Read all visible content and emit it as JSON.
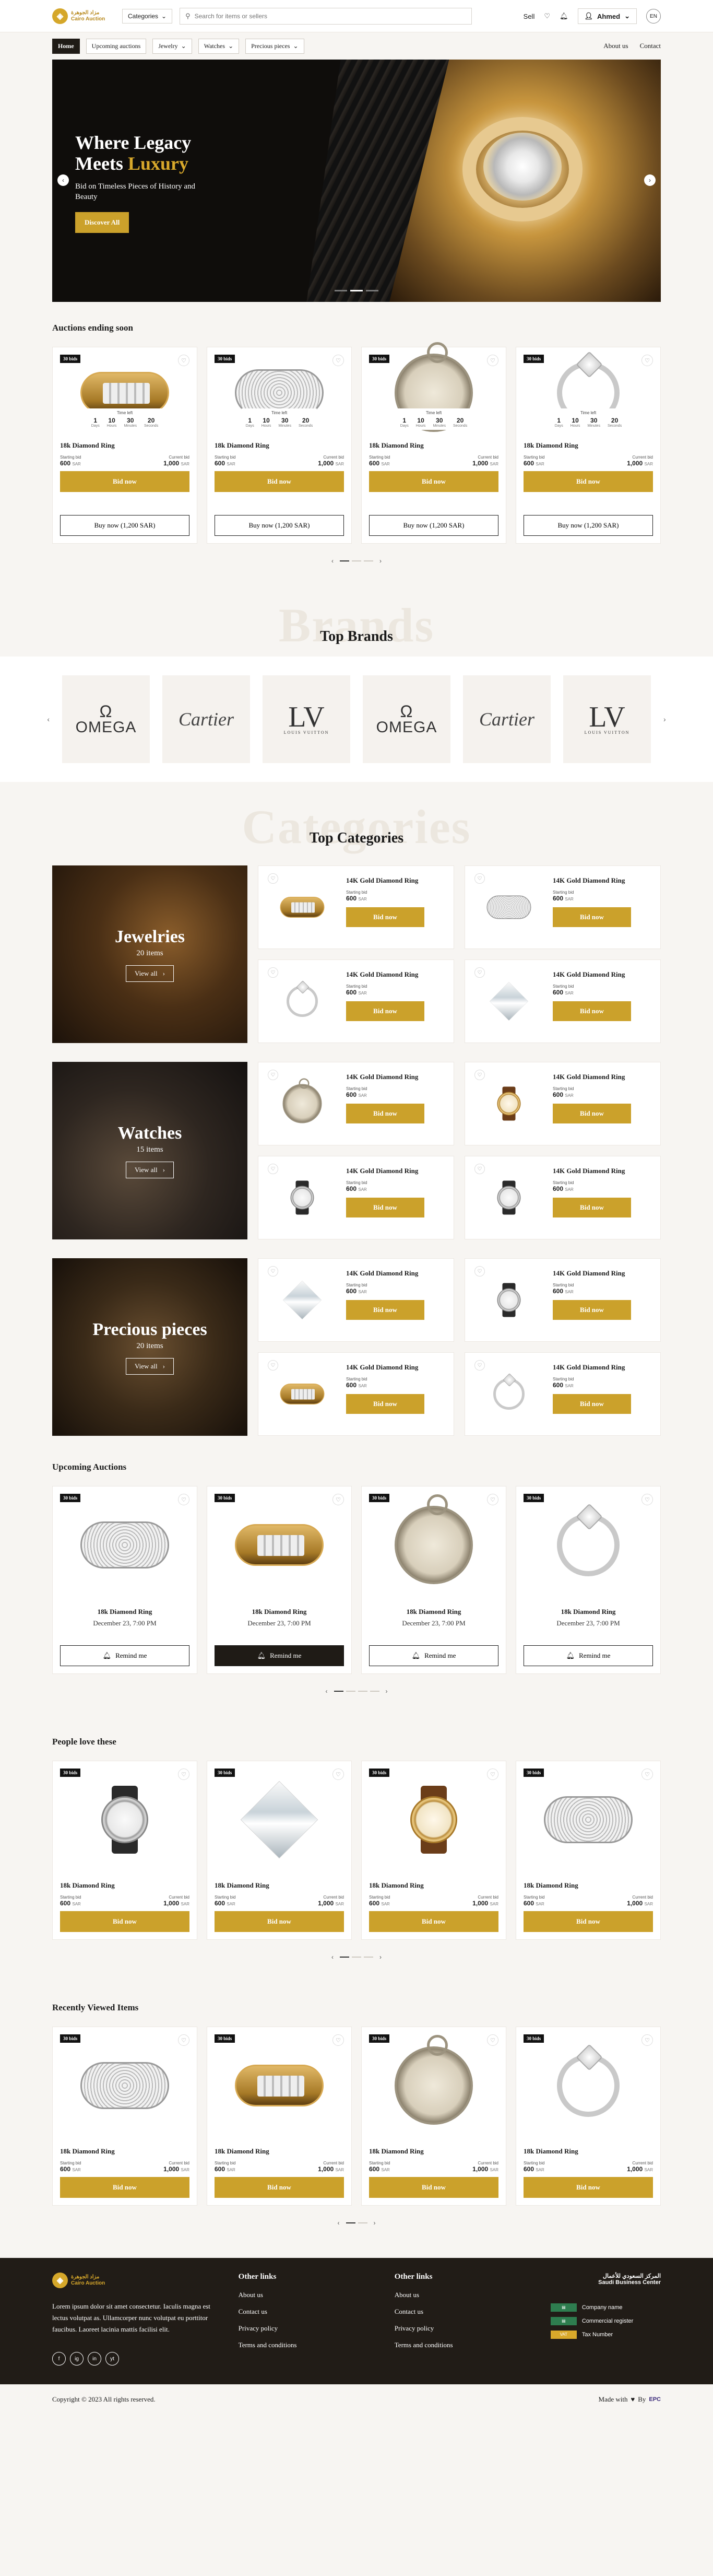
{
  "header": {
    "logo_ar": "مزاد الجوهرة",
    "logo_en": "Cairo Auction",
    "categories_label": "Categories",
    "search_placeholder": "Search for items or sellers",
    "sell": "Sell",
    "user": "Ahmed",
    "lang": "EN"
  },
  "nav": {
    "items": [
      "Home",
      "Upcoming auctions",
      "Jewelry",
      "Watches",
      "Precious pieces"
    ],
    "about": "About us",
    "contact": "Contact"
  },
  "hero": {
    "title_1": "Where Legacy",
    "title_2": "Meets ",
    "title_gold": "Luxury",
    "subtitle": "Bid on Timeless Pieces of History and Beauty",
    "cta": "Discover All"
  },
  "ending": {
    "title": "Auctions ending soon",
    "time_left": "Time left",
    "countdown": [
      {
        "num": "1",
        "unit": "Days"
      },
      {
        "num": "10",
        "unit": "Hours"
      },
      {
        "num": "30",
        "unit": "Minutes"
      },
      {
        "num": "20",
        "unit": "Seconds"
      }
    ],
    "cards": [
      {
        "badge": "30 bids",
        "name": "18k Diamond Ring",
        "start_label": "Starting bid",
        "start": "600",
        "current_label": "Current bid",
        "current": "1,000",
        "currency": "SAR",
        "bid": "Bid now",
        "buy": "Buy now (1,200 SAR)"
      },
      {
        "badge": "30 bids",
        "name": "18k Diamond Ring",
        "start_label": "Starting bid",
        "start": "600",
        "current_label": "Current bid",
        "current": "1,000",
        "currency": "SAR",
        "bid": "Bid now",
        "buy": "Buy now (1,200 SAR)"
      },
      {
        "badge": "30 bids",
        "name": "18k Diamond Ring",
        "start_label": "Starting bid",
        "start": "600",
        "current_label": "Current bid",
        "current": "1,000",
        "currency": "SAR",
        "bid": "Bid now",
        "buy": "Buy now (1,200 SAR)"
      },
      {
        "badge": "30 bids",
        "name": "18k Diamond Ring",
        "start_label": "Starting bid",
        "start": "600",
        "current_label": "Current bid",
        "current": "1,000",
        "currency": "SAR",
        "bid": "Bid now",
        "buy": "Buy now (1,200 SAR)"
      }
    ]
  },
  "brands": {
    "ghost": "Brands",
    "title": "Top Brands",
    "items": [
      "OMEGA",
      "Cartier",
      "LV",
      "OMEGA",
      "Cartier",
      "LV"
    ],
    "lv_caption": "LOUIS VUITTON"
  },
  "categories": {
    "ghost": "Categories",
    "title": "Top Categories",
    "view_all": "View all",
    "groups": [
      {
        "name": "Jewelries",
        "count": "20 items"
      },
      {
        "name": "Watches",
        "count": "15 items"
      },
      {
        "name": "Precious pieces",
        "count": "20 items"
      }
    ],
    "item": {
      "name": "14K Gold Diamond Ring",
      "start_label": "Starting bid",
      "start": "600",
      "currency": "SAR",
      "bid": "Bid now"
    }
  },
  "upcoming": {
    "title": "Upcoming Auctions",
    "cards": [
      {
        "badge": "30 bids",
        "name": "18k Diamond Ring",
        "date": "December 23, 7:00 PM",
        "remind": "Remind me"
      },
      {
        "badge": "30 bids",
        "name": "18k Diamond Ring",
        "date": "December 23, 7:00 PM",
        "remind": "Remind me"
      },
      {
        "badge": "30 bids",
        "name": "18k Diamond Ring",
        "date": "December 23, 7:00 PM",
        "remind": "Remind me"
      },
      {
        "badge": "30 bids",
        "name": "18k Diamond Ring",
        "date": "December 23, 7:00 PM",
        "remind": "Remind me"
      }
    ]
  },
  "people": {
    "title": "People love these",
    "cards": [
      {
        "badge": "30 bids",
        "name": "18k Diamond Ring",
        "start_label": "Starting bid",
        "start": "600",
        "current_label": "Current bid",
        "current": "1,000",
        "currency": "SAR",
        "bid": "Bid now"
      },
      {
        "badge": "30 bids",
        "name": "18k Diamond Ring",
        "start_label": "Starting bid",
        "start": "600",
        "current_label": "Current bid",
        "current": "1,000",
        "currency": "SAR",
        "bid": "Bid now"
      },
      {
        "badge": "30 bids",
        "name": "18k Diamond Ring",
        "start_label": "Starting bid",
        "start": "600",
        "current_label": "Current bid",
        "current": "1,000",
        "currency": "SAR",
        "bid": "Bid now"
      },
      {
        "badge": "30 bids",
        "name": "18k Diamond Ring",
        "start_label": "Starting bid",
        "start": "600",
        "current_label": "Current bid",
        "current": "1,000",
        "currency": "SAR",
        "bid": "Bid now"
      }
    ]
  },
  "recent": {
    "title": "Recently Viewed Items",
    "cards": [
      {
        "badge": "30 bids",
        "name": "18k Diamond Ring",
        "start_label": "Starting bid",
        "start": "600",
        "current_label": "Current bid",
        "current": "1,000",
        "currency": "SAR",
        "bid": "Bid now"
      },
      {
        "badge": "30 bids",
        "name": "18k Diamond Ring",
        "start_label": "Starting bid",
        "start": "600",
        "current_label": "Current bid",
        "current": "1,000",
        "currency": "SAR",
        "bid": "Bid now"
      },
      {
        "badge": "30 bids",
        "name": "18k Diamond Ring",
        "start_label": "Starting bid",
        "start": "600",
        "current_label": "Current bid",
        "current": "1,000",
        "currency": "SAR",
        "bid": "Bid now"
      },
      {
        "badge": "30 bids",
        "name": "18k Diamond Ring",
        "start_label": "Starting bid",
        "start": "600",
        "current_label": "Current bid",
        "current": "1,000",
        "currency": "SAR",
        "bid": "Bid now"
      }
    ]
  },
  "footer": {
    "about": "Lorem ipsum dolor sit amet consectetur. Iaculis magna est lectus volutpat as. Ullamcorper nunc volutpat eu porttitor faucibus. Laoreet lacinia mattis facilisi elit.",
    "col1_title": "Other links",
    "col1_links": [
      "About us",
      "Contact us",
      "Privacy policy",
      "Terms and conditions"
    ],
    "col2_title": "Other links",
    "col2_links": [
      "About us",
      "Contact us",
      "Privacy policy",
      "Terms and conditions"
    ],
    "sbc_ar": "المركز السعودي للأعمال",
    "sbc_en": "Saudi Business Center",
    "sbc_rows": [
      "Company name",
      "Commercial register",
      "Tax Number"
    ],
    "sbc_badge": "VAT",
    "socials": [
      "f",
      "ig",
      "in",
      "yt"
    ],
    "copyright": "Copyright © 2023 All rights reserved.",
    "made_with": "Made with",
    "by": "By",
    "made_by_logo": "EPC"
  }
}
